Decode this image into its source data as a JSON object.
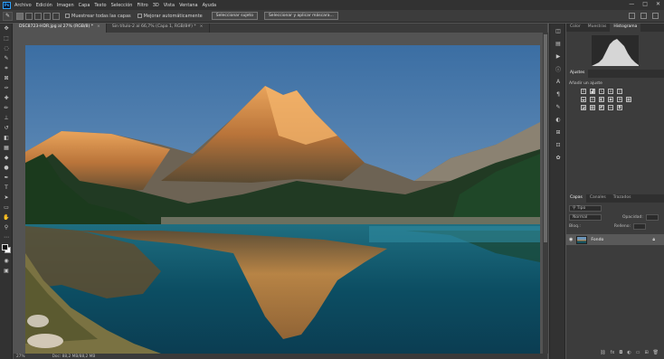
{
  "app": {
    "logo": "Ps"
  },
  "menu": [
    "Archivo",
    "Edición",
    "Imagen",
    "Capa",
    "Texto",
    "Selección",
    "Filtro",
    "3D",
    "Vista",
    "Ventana",
    "Ayuda"
  ],
  "window_controls": [
    "—",
    "□",
    "✕"
  ],
  "options": {
    "sample_all_layers": "Muestrear todas las capas",
    "auto_enhance": "Mejorar automáticamente",
    "select_subject": "Seleccionar sujeto",
    "select_and_mask": "Seleccionar y aplicar máscara..."
  },
  "tabs": [
    {
      "label": "DSC8723-HDR.jpg al 27% (RGB/8) *",
      "close": "×"
    },
    {
      "label": "Sin título-2 al 66,7% (Capa 1, RGB/8#) *",
      "close": "×"
    }
  ],
  "status": {
    "zoom": "27%",
    "doc": "Doc: 88,2 MB/88,2 MB"
  },
  "panels": {
    "top_tabs": [
      "Color",
      "Muestras",
      "Histograma"
    ],
    "adjustments_tab": "Ajustes",
    "adjustments_sub": "Añadir un ajuste",
    "layers_tabs": [
      "Capas",
      "Canales",
      "Trazados"
    ],
    "layers_search": "Tipo",
    "blend_mode": "Normal",
    "opacity_label": "Opacidad:",
    "fill_label": "Relleno:",
    "lock_label": "Bloq.:",
    "layer_name": "Fondo"
  },
  "colors": {
    "menubar": "#323232",
    "panel": "#3c3c3c",
    "workspace": "#535353",
    "accent": "#2fa3ff"
  }
}
